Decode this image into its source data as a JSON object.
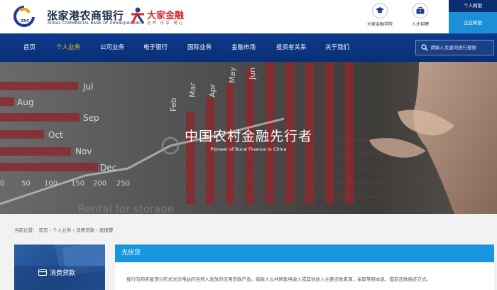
{
  "header": {
    "logo_badge": "ZRC BANK",
    "bank_name_cn": "张家港农商银行",
    "bank_name_en": "RURAL COMMERCIAL BANK OF ZHANGJIAGANG",
    "brand_title": "大家金融",
    "brand_sub": "无界 乐享 随心",
    "quick_links": [
      {
        "label": "大家金融学院",
        "icon": "graduation-cap-icon"
      },
      {
        "label": "人才招聘",
        "icon": "briefcase-icon"
      }
    ],
    "personal_banking": "个人网银",
    "corporate_banking": "企业网银"
  },
  "nav": {
    "items": [
      "首页",
      "个人业务",
      "公司业务",
      "电子银行",
      "国际业务",
      "金融市场",
      "投资者关系",
      "关于我们"
    ],
    "active_index": 1,
    "search_placeholder": "请输入关键词进行搜索"
  },
  "banner": {
    "title": "中国农村金融先行者",
    "subtitle": "Pioneer of Rural Finance in China",
    "months_left": [
      "Jul",
      "Aug",
      "Sep",
      "Oct",
      "Nov",
      "Dec"
    ],
    "months_top": [
      "Feb",
      "Mar",
      "Apr",
      "May",
      "Jun"
    ],
    "axis_numbers": [
      "0",
      "50",
      "100",
      "150",
      "200",
      "250"
    ],
    "bottom_text": "Rental for storage",
    "top_text": "Apr",
    "top_text2": "May"
  },
  "breadcrumb": {
    "prefix": "当前位置：",
    "items": [
      "首页",
      "个人业务",
      "消费贷款",
      "光伏贷"
    ],
    "separator": "›"
  },
  "sidebar": {
    "card_label": "消费贷款",
    "card_icon": "card-icon"
  },
  "content": {
    "title": "光伏贷",
    "description": "我行向购买屋顶分布式光伏电站的自然人发放的信用贷款产品。借款人以并网售电收入或其他收入主要还款来源，采取等额本息、提前还款偿还方式。"
  },
  "colors": {
    "nav_bg": "#0d3a8c",
    "nav_active": "#f6c21a",
    "panel_head": "#1996e0",
    "corp_banking_bg": "#1d8fd8",
    "personal_banking_bg": "#0a2d6f"
  }
}
